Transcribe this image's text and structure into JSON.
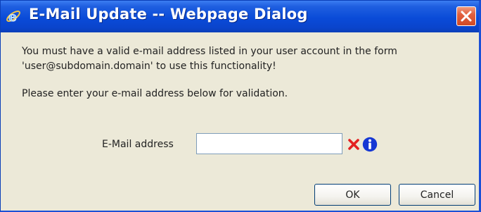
{
  "window": {
    "title": "E-Mail Update -- Webpage Dialog",
    "title_icon": "ie-icon",
    "close_icon": "close-icon",
    "titlebar_color": "#0a4bd8",
    "close_color": "#d24a25"
  },
  "dialog": {
    "message_line1": "You must have a valid e-mail address listed in your user account in the form",
    "message_line2": "'user@subdomain.domain' to use this functionality!",
    "instruction": "Please enter your e-mail address below for validation.",
    "email_label": "E-Mail address",
    "email_value": "",
    "error_icon": "error-x-icon",
    "error_color": "#e32020",
    "info_icon": "info-icon",
    "info_color": "#1638d4"
  },
  "buttons": {
    "ok_label": "OK",
    "cancel_label": "Cancel"
  }
}
